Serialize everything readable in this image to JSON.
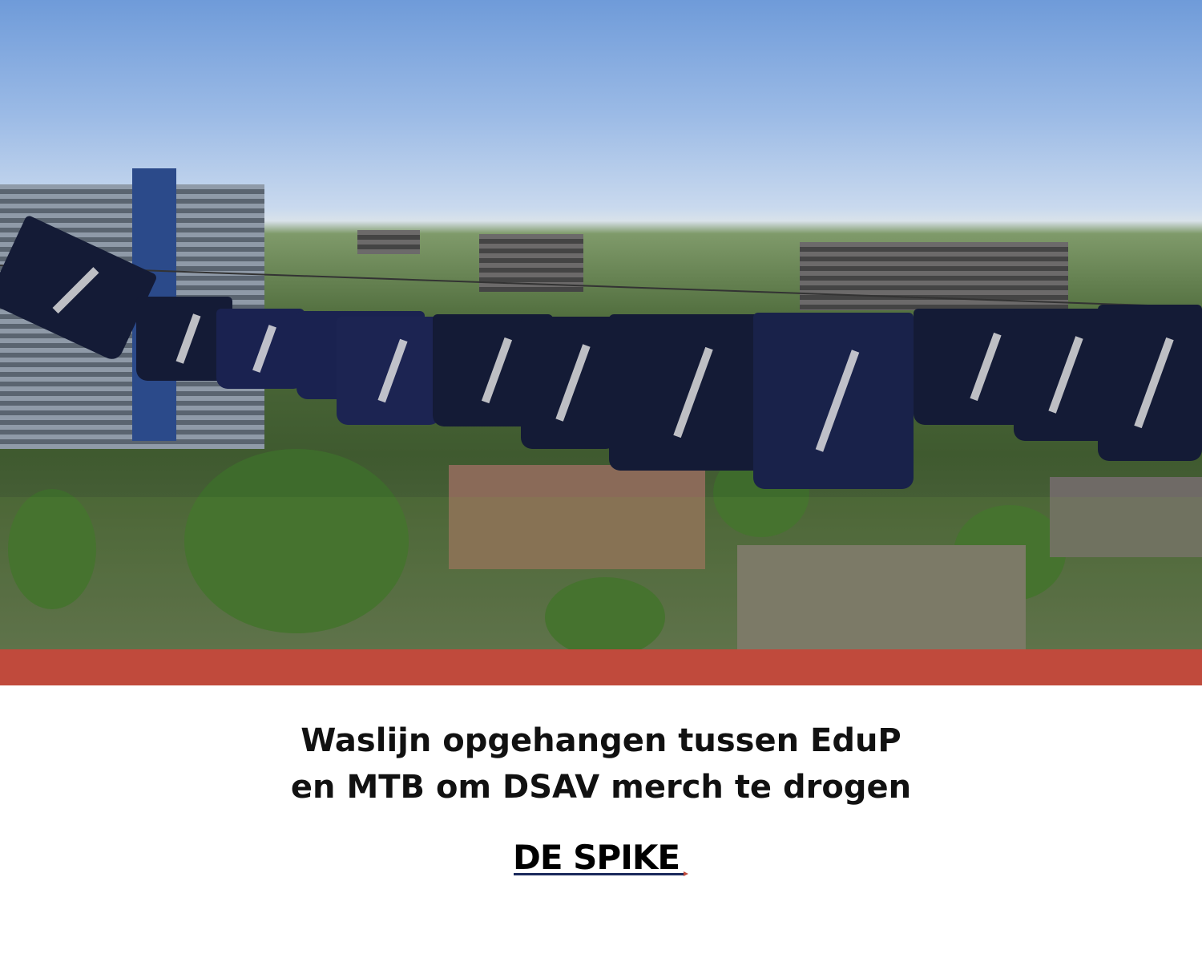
{
  "photo": {
    "description_icon": "photo-clothesline-over-city"
  },
  "caption": {
    "line1": "Waslijn opgehangen tussen EduP",
    "line2": "en MTB om DSAV merch te drogen"
  },
  "logo": {
    "text": "DE SPIKE"
  },
  "colors": {
    "band": "#c04a3c",
    "logo_underline": "#1b2a5c"
  }
}
